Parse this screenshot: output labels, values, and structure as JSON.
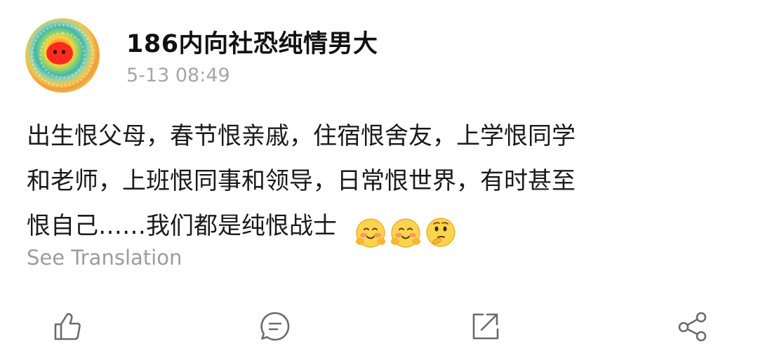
{
  "post": {
    "author": {
      "name": "186内向社恐纯情男大",
      "avatar_icon": "psychedelic-face-avatar"
    },
    "timestamp": "5-13 08:49",
    "body_lines": [
      "出生恨父母，春节恨亲戚，住宿恨舍友，上学恨同学",
      "和老师，上班恨同事和领导，日常恨世界，有时甚至",
      "恨自己……我们都是纯恨战士"
    ],
    "emojis": [
      "blushing-hands-emoji",
      "blushing-hands-emoji",
      "thinking-face-emoji"
    ],
    "see_translation_label": "See Translation"
  },
  "actions": [
    {
      "name": "like",
      "icon": "thumbs-up-icon"
    },
    {
      "name": "comment",
      "icon": "comment-icon"
    },
    {
      "name": "repost",
      "icon": "repost-icon"
    },
    {
      "name": "share",
      "icon": "share-icon"
    }
  ],
  "colors": {
    "text": "#1a1a1a",
    "muted": "#a6a6a6",
    "icon": "#6b6b6b",
    "background": "#ffffff"
  }
}
